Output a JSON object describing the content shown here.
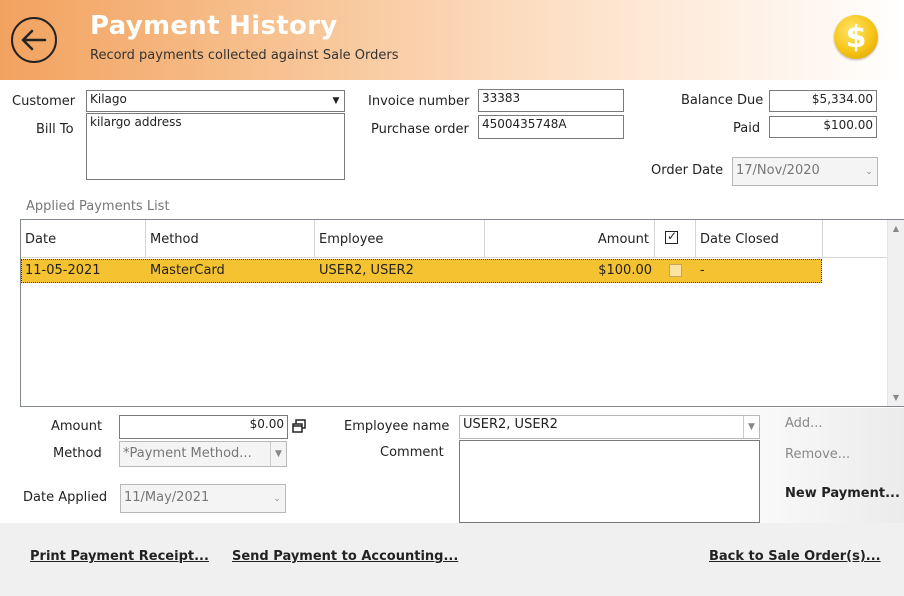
{
  "header": {
    "title": "Payment History",
    "subtitle": "Record payments collected against Sale Orders",
    "coin_symbol": "$"
  },
  "form": {
    "customer_label": "Customer",
    "customer_value": "Kilago",
    "bill_to_label": "Bill To",
    "bill_to_value": "kilargo address",
    "invoice_label": "Invoice number",
    "invoice_value": "33383",
    "purchase_order_label": "Purchase order",
    "purchase_order_value": "4500435748A",
    "balance_due_label": "Balance Due",
    "balance_due_value": "$5,334.00",
    "paid_label": "Paid",
    "paid_value": "$100.00",
    "order_date_label": "Order Date",
    "order_date_value": "17/Nov/2020"
  },
  "payments": {
    "section_label": "Applied Payments List",
    "columns": {
      "date": "Date",
      "method": "Method",
      "employee": "Employee",
      "amount": "Amount",
      "date_closed": "Date Closed"
    },
    "rows": [
      {
        "date": "11-05-2021",
        "method": "MasterCard",
        "employee": "USER2, USER2",
        "amount": "$100.00",
        "date_closed": "-"
      }
    ]
  },
  "entry": {
    "amount_label": "Amount",
    "amount_value": "$0.00",
    "method_label": "Method",
    "method_placeholder": "*Payment Method...",
    "date_applied_label": "Date Applied",
    "date_applied_value": "11/May/2021",
    "employee_label": "Employee name",
    "employee_value": "USER2, USER2",
    "comment_label": "Comment",
    "comment_value": ""
  },
  "actions": {
    "add": "Add...",
    "remove": "Remove...",
    "new_payment": "New Payment..."
  },
  "footer": {
    "print_receipt": "Print Payment Receipt...",
    "send_accounting": "Send Payment to Accounting...",
    "back_sale_orders": "Back to Sale Order(s)..."
  },
  "icons": {
    "back": "back-arrow-icon",
    "coin": "dollar-coin-icon",
    "dropdown": "chevron-down-icon",
    "calculator": "calculator-icon"
  },
  "colors": {
    "header_accent": "#f2a25f",
    "selected_row": "#f5c231",
    "coin": "#f6c416"
  }
}
